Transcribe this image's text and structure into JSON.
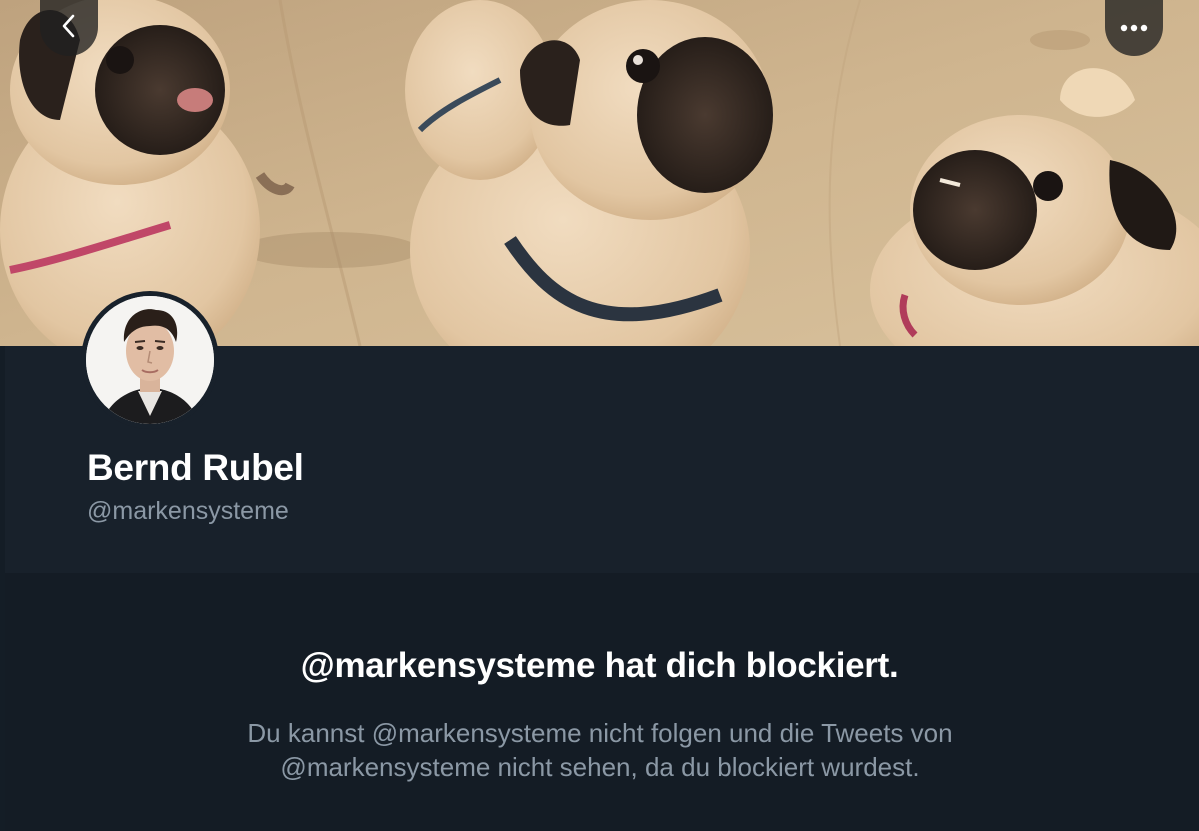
{
  "header": {
    "back_icon": "chevron-left-icon",
    "more_icon": "more-dots-icon"
  },
  "profile": {
    "name": "Bernd Rubel",
    "handle": "@markensysteme"
  },
  "blocked": {
    "title": "@markensysteme hat dich blockiert.",
    "message_line1": "Du kannst @markensysteme nicht folgen und die Tweets von",
    "message_line2": "@markensysteme nicht sehen, da du blockiert wurdest."
  },
  "colors": {
    "background": "#141d26",
    "profile_panel": "#18212b",
    "secondary_text": "#8b98a5",
    "primary_text": "#ffffff"
  }
}
